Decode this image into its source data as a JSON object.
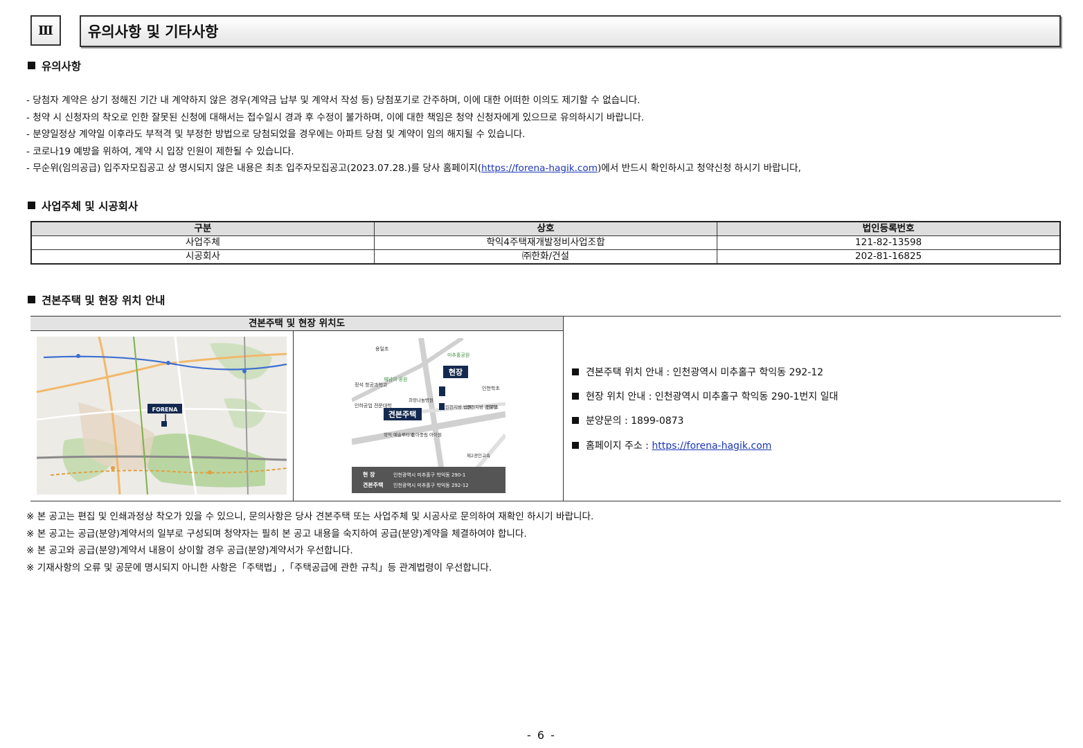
{
  "header": {
    "number": "Ⅲ",
    "title": "유의사항 및 기타사항"
  },
  "notice": {
    "heading": "유의사항",
    "items": [
      "- 당첨자 계약은 상기 정해진 기간 내 계약하지 않은 경우(계약금 납부 및 계약서 작성 등) 당첨포기로 간주하며, 이에 대한 어떠한 이의도 제기할 수 없습니다.",
      "- 청약 시 신청자의 착오로 인한 잘못된 신청에 대해서는 접수일시 경과 후 수정이 불가하며, 이에 대한 책임은 청약 신청자에게 있으므로 유의하시기 바랍니다.",
      "- 분양일정상 계약일 이후라도 부적격 및 부정한 방법으로 당첨되었을 경우에는 아파트 당첨 및 계약이 임의 해지될 수 있습니다.",
      "- 코로나19 예방을 위하여, 계약 시 입장 인원이 제한될 수 있습니다."
    ],
    "last_item_prefix": "- 무순위(임의공급) 입주자모집공고 상 명시되지 않은 내용은 최초 입주자모집공고(2023.07.28.)를 당사 홈페이지(",
    "last_item_link": "https://forena-hagik.com",
    "last_item_suffix": ")에서 반드시 확인하시고 청약신청 하시기 바랍니다,"
  },
  "company": {
    "heading": "사업주체 및 시공회사",
    "columns": [
      "구분",
      "상호",
      "법인등록번호"
    ],
    "rows": [
      [
        "사업주체",
        "학익4주택재개발정비사업조합",
        "121-82-13598"
      ],
      [
        "시공회사",
        "㈜한화/건설",
        "202-81-16825"
      ]
    ]
  },
  "location": {
    "heading": "견본주택 및 현장 위치 안내",
    "table_title": "견본주택 및 현장 위치도",
    "map1": {
      "brand": "FORENA"
    },
    "map2": {
      "labels": [
        "용일초",
        "미추홀공원",
        "현장",
        "재넘이 공원",
        "정석 항공과학고",
        "인하공업 전문대학",
        "인천학초",
        "희망나눔병원",
        "인천지방 법원",
        "인천지방 검찰청",
        "인주초",
        "견본주택",
        "학익 예술루타워",
        "동아풍림 아이원",
        "제2경인고속"
      ],
      "site_label": "현장",
      "model_label": "견본주택",
      "legend_site_title": "현 장",
      "legend_site_addr": "인천광역시 미추홀구 학익동 290-1",
      "legend_model_title": "견본주택",
      "legend_model_addr": "인천광역시 미추홀구 학익동 292-12"
    },
    "info": [
      "견본주택 위치 안내 : 인천광역시 미추홀구 학익동 292-12",
      "현장 위치 안내 : 인천광역시 미추홀구 학익동 290-1번지 일대",
      "분양문의 : 1899-0873"
    ],
    "homepage_label": "홈페이지 주소 : ",
    "homepage_link": "https://forena-hagik.com"
  },
  "footnotes": [
    "※ 본 공고는 편집 및 인쇄과정상 착오가 있을 수 있으니, 문의사항은 당사 견본주택 또는 사업주체 및 시공사로 문의하여 재확인 하시기 바랍니다.",
    "※ 본 공고는 공급(분양)계약서의 일부로 구성되며 청약자는 필히 본 공고 내용을 숙지하여 공급(분양)계약을 체결하여야 합니다.",
    "※ 본 공고와 공급(분양)계약서 내용이 상이할 경우 공급(분양)계약서가 우선합니다.",
    "※ 기재사항의 오류 및 공문에 명시되지 아니한 사항은「주택법」,「주택공급에 관한 규칙」등 관계법령이 우선합니다."
  ],
  "page_number": "- 6 -",
  "colors": {
    "navy": "#14294f",
    "link": "#1a35b8",
    "header_bg": "#dedede"
  }
}
